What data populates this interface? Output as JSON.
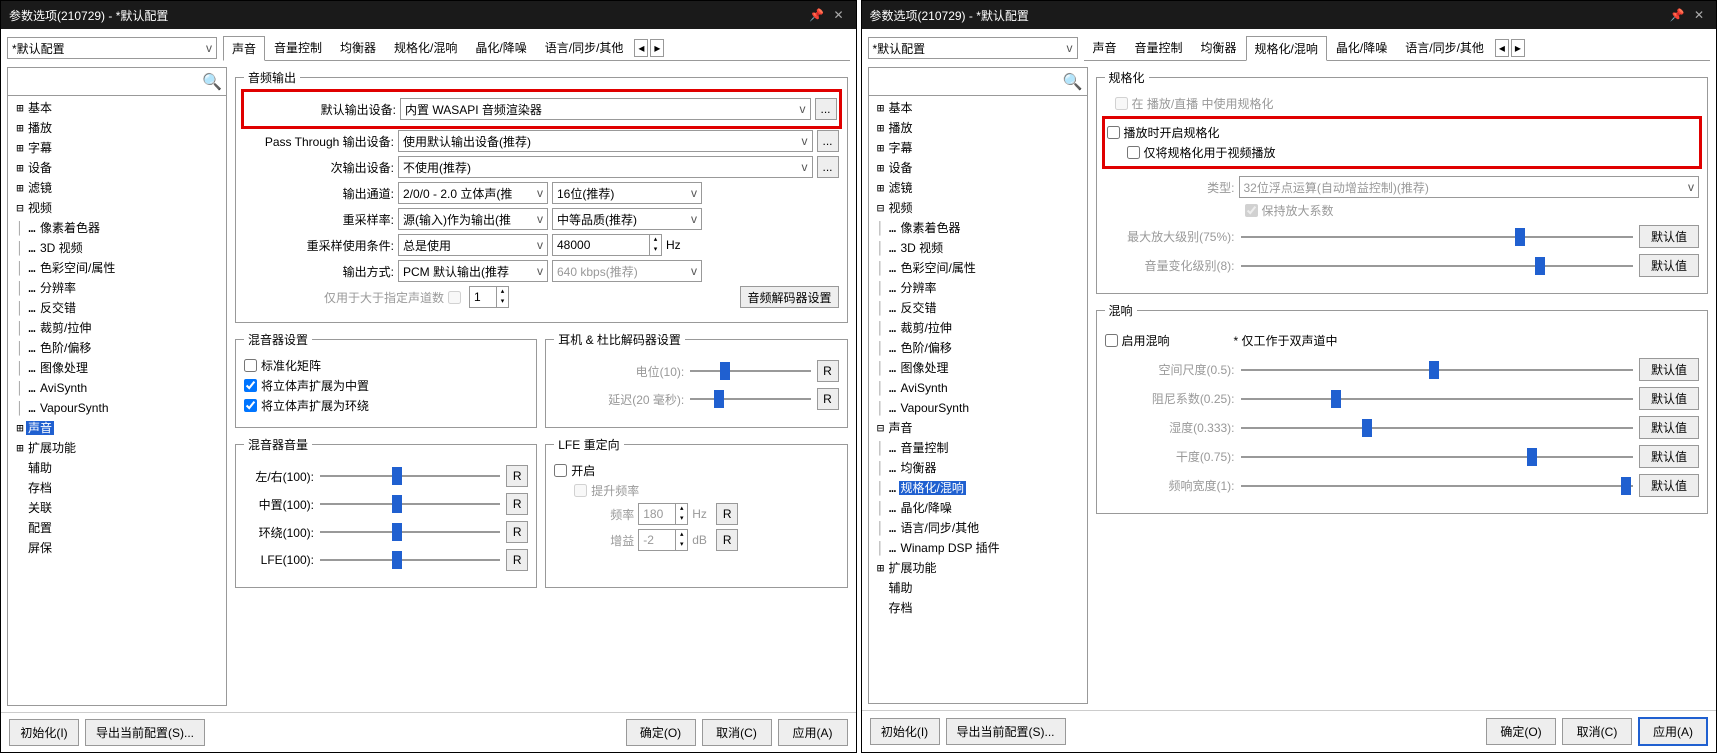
{
  "title": "参数选项(210729) - *默认配置",
  "profile": "*默认配置",
  "tabs": [
    "声音",
    "音量控制",
    "均衡器",
    "规格化/混响",
    "晶化/降噪",
    "语言/同步/其他"
  ],
  "activeTabLeft": "声音",
  "activeTabRight": "规格化/混响",
  "search_placeholder": "",
  "tree": [
    {
      "exp": "⊞",
      "label": "基本"
    },
    {
      "exp": "⊞",
      "label": "播放"
    },
    {
      "exp": "⊞",
      "label": "字幕"
    },
    {
      "exp": "⊞",
      "label": "设备"
    },
    {
      "exp": "⊞",
      "label": "滤镜"
    },
    {
      "exp": "⊟",
      "label": "视频",
      "children": [
        {
          "label": "像素着色器"
        },
        {
          "label": "3D 视频"
        },
        {
          "label": "色彩空间/属性"
        },
        {
          "label": "分辨率"
        },
        {
          "label": "反交错"
        },
        {
          "label": "裁剪/拉伸"
        },
        {
          "label": "色阶/偏移"
        },
        {
          "label": "图像处理"
        },
        {
          "label": "AviSynth"
        },
        {
          "label": "VapourSynth"
        }
      ]
    },
    {
      "exp": "⊞",
      "label": "声音",
      "selected": true
    },
    {
      "exp": "⊞",
      "label": "扩展功能"
    },
    {
      "exp": " ",
      "label": "辅助"
    },
    {
      "exp": " ",
      "label": "存档"
    },
    {
      "exp": " ",
      "label": "关联"
    },
    {
      "exp": " ",
      "label": "配置"
    },
    {
      "exp": " ",
      "label": "屏保"
    }
  ],
  "treeRight": [
    {
      "exp": "⊞",
      "label": "基本"
    },
    {
      "exp": "⊞",
      "label": "播放"
    },
    {
      "exp": "⊞",
      "label": "字幕"
    },
    {
      "exp": "⊞",
      "label": "设备"
    },
    {
      "exp": "⊞",
      "label": "滤镜"
    },
    {
      "exp": "⊟",
      "label": "视频",
      "children": [
        {
          "label": "像素着色器"
        },
        {
          "label": "3D 视频"
        },
        {
          "label": "色彩空间/属性"
        },
        {
          "label": "分辨率"
        },
        {
          "label": "反交错"
        },
        {
          "label": "裁剪/拉伸"
        },
        {
          "label": "色阶/偏移"
        },
        {
          "label": "图像处理"
        },
        {
          "label": "AviSynth"
        },
        {
          "label": "VapourSynth"
        }
      ]
    },
    {
      "exp": "⊟",
      "label": "声音",
      "children": [
        {
          "label": "音量控制"
        },
        {
          "label": "均衡器"
        },
        {
          "label": "规格化/混响",
          "selected": true
        },
        {
          "label": "晶化/降噪"
        },
        {
          "label": "语言/同步/其他"
        },
        {
          "label": "Winamp DSP 插件"
        }
      ]
    },
    {
      "exp": "⊞",
      "label": "扩展功能"
    },
    {
      "exp": " ",
      "label": "辅助"
    },
    {
      "exp": " ",
      "label": "存档"
    }
  ],
  "audio_output": {
    "legend": "音频输出",
    "default_device_lbl": "默认输出设备:",
    "default_device": "内置 WASAPI 音频渲染器",
    "passthrough_lbl": "Pass Through 输出设备:",
    "passthrough": "使用默认输出设备(推荐)",
    "secondary_lbl": "次输出设备:",
    "secondary": "不使用(推荐)",
    "channel_lbl": "输出通道:",
    "channel": "2/0/0 - 2.0 立体声(推",
    "bit": "16位(推荐)",
    "resample_rate_lbl": "重采样率:",
    "resample_rate": "源(输入)作为输出(推",
    "resample_quality": "中等品质(推荐)",
    "resample_cond_lbl": "重采样使用条件:",
    "resample_cond": "总是使用",
    "resample_hz": "48000",
    "hz": "Hz",
    "output_method_lbl": "输出方式:",
    "output_method": "PCM 默认输出(推荐",
    "bitrate": "640 kbps(推荐)",
    "threshold_lbl": "仅用于大于指定声道数",
    "threshold": "1",
    "decoder_btn": "音频解码器设置"
  },
  "mixer": {
    "legend": "混音器设置",
    "norm_matrix": "标准化矩阵",
    "stereo_center": "将立体声扩展为中置",
    "stereo_surround": "将立体声扩展为环绕"
  },
  "mixer_vol": {
    "legend": "混音器音量",
    "lr": "左/右(100):",
    "center": "中置(100):",
    "surround": "环绕(100):",
    "lfe": "LFE(100):",
    "r": "R"
  },
  "headphone": {
    "legend": "耳机 & 杜比解码器设置",
    "level": "电位(10):",
    "delay": "延迟(20 毫秒):",
    "r": "R"
  },
  "lfe_redirect": {
    "legend": "LFE 重定向",
    "enable": "开启",
    "boost": "提升频率",
    "freq_lbl": "频率",
    "freq": "180",
    "freq_unit": "Hz",
    "gain_lbl": "增益",
    "gain": "-2",
    "gain_unit": "dB",
    "r": "R"
  },
  "normalize": {
    "legend": "规格化",
    "use_on_live": "在 播放/直播 中使用规格化",
    "enable_on_play": "播放时开启规格化",
    "video_only": "仅将规格化用于视频播放",
    "type_lbl": "类型:",
    "type": "32位浮点运算(自动增益控制)(推荐)",
    "keep_gain": "保持放大系数",
    "max_gain": "最大放大级别(75%):",
    "vol_change": "音量变化级别(8):",
    "def": "默认值"
  },
  "reverb": {
    "legend": "混响",
    "enable": "启用混响",
    "note": "* 仅工作于双声道中",
    "room": "空间尺度(0.5):",
    "damp": "阻尼系数(0.25):",
    "wet": "湿度(0.333):",
    "dry": "干度(0.75):",
    "width": "频响宽度(1):",
    "def": "默认值"
  },
  "footer": {
    "init": "初始化(I)",
    "export": "导出当前配置(S)...",
    "ok": "确定(O)",
    "cancel": "取消(C)",
    "apply": "应用(A)"
  }
}
